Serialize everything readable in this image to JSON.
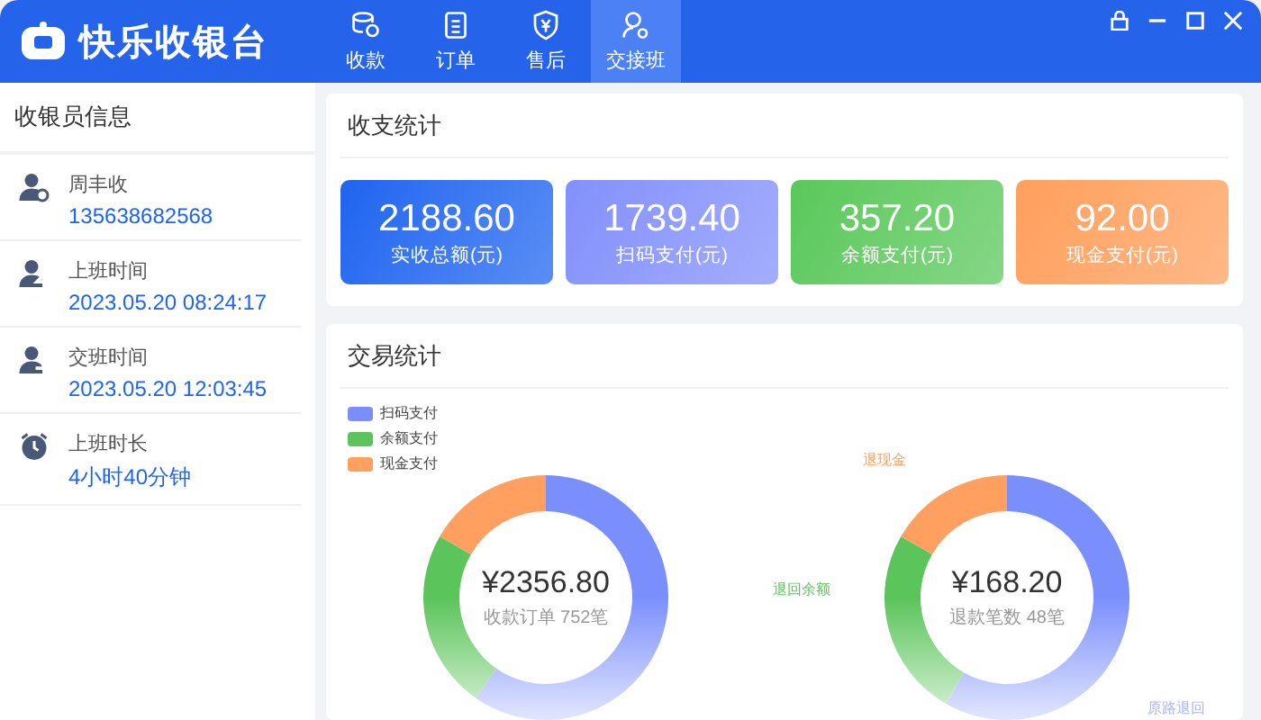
{
  "app": {
    "title": "快乐收银台"
  },
  "tabs": [
    {
      "label": "收款",
      "selected": false
    },
    {
      "label": "订单",
      "selected": false
    },
    {
      "label": "售后",
      "selected": false
    },
    {
      "label": "交接班",
      "selected": true
    }
  ],
  "sidebar": {
    "title": "收银员信息",
    "items": [
      {
        "label": "周丰收",
        "value": "135638682568"
      },
      {
        "label": "上班时间",
        "value": "2023.05.20 08:24:17"
      },
      {
        "label": "交班时间",
        "value": "2023.05.20 12:03:45"
      },
      {
        "label": "上班时长",
        "value": "4小时40分钟"
      }
    ]
  },
  "income_stats": {
    "title": "收支统计",
    "cards": [
      {
        "value": "2188.60",
        "label": "实收总额(元)",
        "color": "#1f64f0"
      },
      {
        "value": "1739.40",
        "label": "扫码支付(元)",
        "color": "#8290fb"
      },
      {
        "value": "357.20",
        "label": "余额支付(元)",
        "color": "#5ac85a"
      },
      {
        "value": "92.00",
        "label": "现金支付(元)",
        "color": "#ff9f5c"
      }
    ]
  },
  "trade_stats": {
    "title": "交易统计",
    "legend": [
      {
        "label": "扫码支付",
        "color": "#7b8ffc"
      },
      {
        "label": "余额支付",
        "color": "#5bc45b"
      },
      {
        "label": "现金支付",
        "color": "#ffa060"
      }
    ],
    "donuts": [
      {
        "amount": "¥2356.80",
        "caption": "收款订单 752笔"
      },
      {
        "amount": "¥168.20",
        "caption": "退款笔数 48笔",
        "labels": [
          {
            "text": "退现金",
            "color": "#ffa060"
          },
          {
            "text": "退回余额",
            "color": "#5bc45b"
          },
          {
            "text": "原路退回",
            "color": "#a9b4fd"
          }
        ]
      }
    ]
  }
}
